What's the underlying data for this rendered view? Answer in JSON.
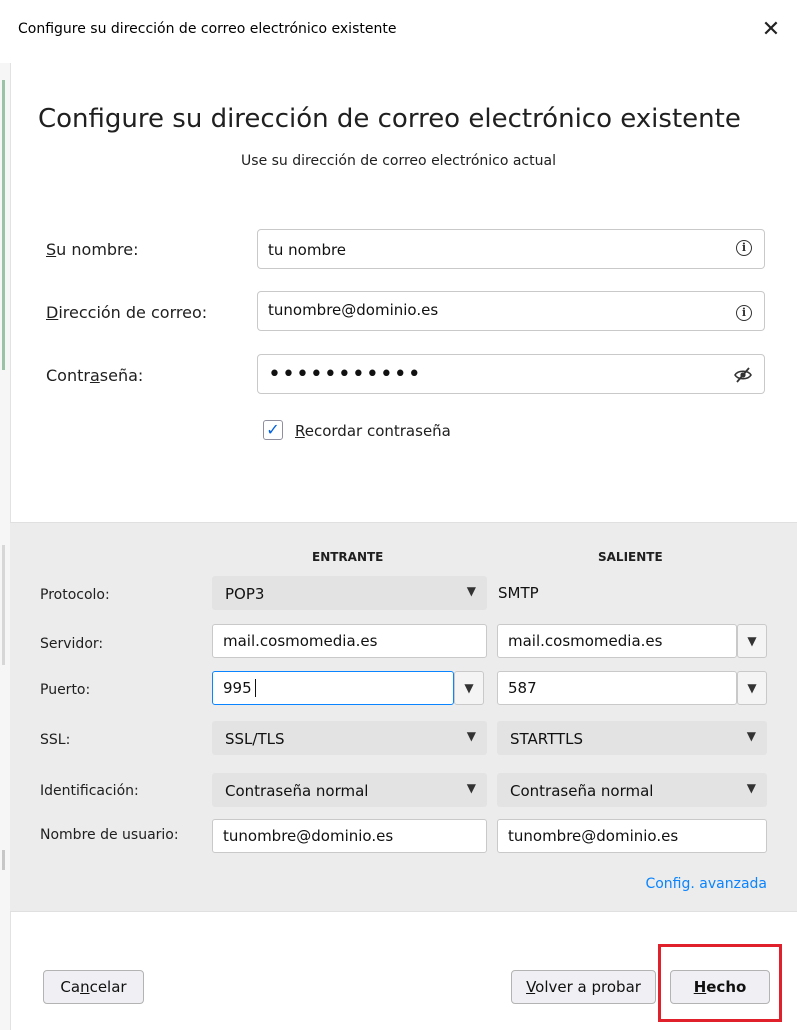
{
  "window": {
    "title": "Configure su dirección de correo electrónico existente",
    "close_glyph": "✕"
  },
  "header": {
    "title": "Configure su dirección de correo electrónico existente",
    "subtitle": "Use su dirección de correo electrónico actual"
  },
  "form": {
    "name_label_access": "S",
    "name_label_rest": "u nombre:",
    "name_value": "tu nombre",
    "email_label_access": "D",
    "email_label_rest": "irección de correo:",
    "email_value": "tunombre@dominio.es",
    "password_label_pre": "Contr",
    "password_label_access": "a",
    "password_label_post": "seña:",
    "password_value": "•••••••••••",
    "remember_access": "R",
    "remember_rest": "ecordar contraseña",
    "remember_checked": true,
    "info_icon": "info-icon",
    "eye_icon": "eye-slash-icon"
  },
  "server": {
    "incoming_header": "ENTRANTE",
    "outgoing_header": "SALIENTE",
    "rows": {
      "protocol": {
        "label": "Protocolo:",
        "incoming": "POP3",
        "outgoing": "SMTP"
      },
      "server": {
        "label": "Servidor:",
        "incoming": "mail.cosmomedia.es",
        "outgoing": "mail.cosmomedia.es"
      },
      "port": {
        "label": "Puerto:",
        "incoming": "995",
        "outgoing": "587"
      },
      "ssl": {
        "label": "SSL:",
        "incoming": "SSL/TLS",
        "outgoing": "STARTTLS"
      },
      "auth": {
        "label": "Identificación:",
        "incoming": "Contraseña normal",
        "outgoing": "Contraseña normal"
      },
      "username": {
        "label": "Nombre de usuario:",
        "incoming": "tunombre@dominio.es",
        "outgoing": "tunombre@dominio.es"
      }
    },
    "advanced_link": "Config. avanzada",
    "chevron_glyph": "❯"
  },
  "footer": {
    "cancel_pre": "Ca",
    "cancel_access": "n",
    "cancel_post": "celar",
    "retry_access": "V",
    "retry_rest": "olver a probar",
    "done_access": "H",
    "done_rest": "echo"
  },
  "colors": {
    "accent": "#0a84ff",
    "highlight": "#e0202b",
    "panel": "#ececec"
  }
}
